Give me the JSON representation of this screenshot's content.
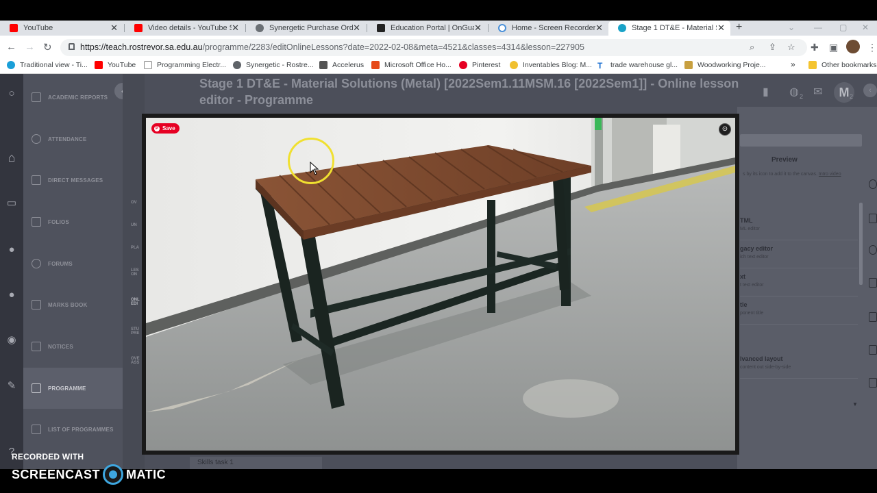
{
  "browser": {
    "tabs": [
      {
        "label": "YouTube",
        "favicon_color": "#ff0000",
        "icon": "youtube-icon"
      },
      {
        "label": "Video details - YouTube Stu",
        "favicon_color": "#ff0000",
        "icon": "youtube-studio-icon"
      },
      {
        "label": "Synergetic Purchase Order",
        "favicon_color": "#5f6368",
        "icon": "globe-icon"
      },
      {
        "label": "Education Portal | OnGuard",
        "favicon_color": "#222222",
        "icon": "onguard-icon"
      },
      {
        "label": "Home - Screen Recorder & ",
        "favicon_color": "#4a90d9",
        "icon": "screencast-icon"
      },
      {
        "label": "Stage 1 DT&E - Material So",
        "favicon_color": "#1aa3c8",
        "icon": "schoolbox-icon"
      }
    ],
    "active_tab_index": 5,
    "url_host": "https://teach.rostrevor.sa.edu.au",
    "url_path": "/programme/2283/editOnlineLessons?date=2022-02-08&meta=4521&classes=4314&lesson=227905",
    "bookmarks": [
      {
        "label": "Traditional view - Ti...",
        "color": "#1a9fd8",
        "icon": "schoolbox-icon"
      },
      {
        "label": "YouTube",
        "color": "#ff0000",
        "icon": "youtube-icon"
      },
      {
        "label": "Programming Electr...",
        "color": "#888888",
        "icon": "grid-icon"
      },
      {
        "label": "Synergetic - Rostre...",
        "color": "#5f6368",
        "icon": "globe-icon"
      },
      {
        "label": "Accelerus",
        "color": "#555555",
        "icon": "accelerus-icon"
      },
      {
        "label": "Microsoft Office Ho...",
        "color": "#e64a19",
        "icon": "office-icon"
      },
      {
        "label": "Pinterest",
        "color": "#e60023",
        "icon": "pinterest-icon"
      },
      {
        "label": "Inventables Blog: M...",
        "color": "#f0c030",
        "icon": "inventables-icon"
      },
      {
        "label": "trade warehouse gl...",
        "color": "#1a6fd0",
        "icon": "t-icon"
      },
      {
        "label": "Woodworking Proje...",
        "color": "#c8a040",
        "icon": "woodworking-icon"
      }
    ],
    "bookmarks_more": "»",
    "other_bookmarks": "Other bookmarks"
  },
  "lms": {
    "page_title": "Stage 1 DT&E - Material Solutions (Metal) [2022Sem1.11MSM.16 [2022Sem1]] - Online lesson editor - Programme",
    "nav_items": [
      {
        "label": "ACADEMIC REPORTS"
      },
      {
        "label": "ATTENDANCE"
      },
      {
        "label": "DIRECT MESSAGES"
      },
      {
        "label": "FOLIOS"
      },
      {
        "label": "FORUMS"
      },
      {
        "label": "MARKS BOOK"
      },
      {
        "label": "NOTICES"
      },
      {
        "label": "PROGRAMME"
      },
      {
        "label": "LIST OF PROGRAMMES"
      }
    ],
    "active_nav_index": 7,
    "subnav_items": [
      "OV",
      "UN",
      "PLA",
      "LES ON",
      "ONL EDI",
      "STU PRE",
      "OVE ASS"
    ],
    "avatar_letter": "M",
    "avatar_badge": "2",
    "globe_badge": "2",
    "preview_label": "Preview",
    "preview_hint": "s by its icon to add it to the canvas.",
    "preview_hint_link": "Intro video",
    "content_blocks": [
      {
        "title": "TML",
        "desc": "ML editor"
      },
      {
        "title": "gacy editor",
        "desc": "ich text editor"
      },
      {
        "title": "xt",
        "desc": "t text editor"
      },
      {
        "title": "tle",
        "desc": "ponent title"
      },
      {
        "title": "lvanced layout",
        "desc": "content out side-by-side"
      }
    ],
    "skills_tab": "Skills task 1"
  },
  "lightbox": {
    "save_label": "Save",
    "photo_subject": "Wooden slat bench on black steel frame"
  },
  "watermark": {
    "line1": "RECORDED WITH",
    "left_word": "SCREENCAST",
    "right_word": "MATIC"
  }
}
